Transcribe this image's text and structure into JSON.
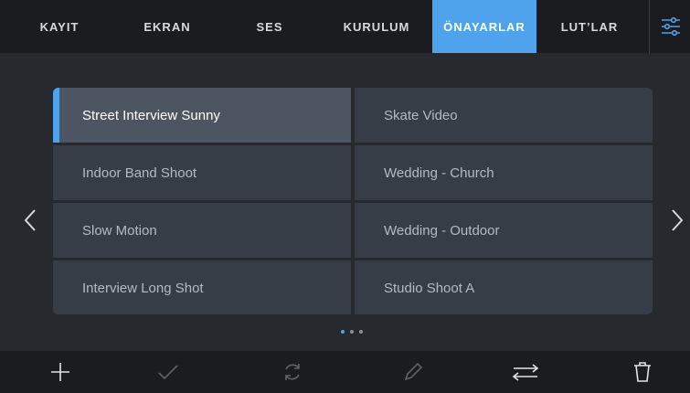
{
  "tabs": [
    {
      "label": "KAYIT"
    },
    {
      "label": "EKRAN"
    },
    {
      "label": "SES"
    },
    {
      "label": "KURULUM"
    },
    {
      "label": "ÖNAYARLAR",
      "active": true
    },
    {
      "label": "LUT’LAR"
    }
  ],
  "menu_icon": "sliders-icon",
  "presets": {
    "left": [
      {
        "label": "Street Interview Sunny",
        "selected": true
      },
      {
        "label": "Indoor Band Shoot"
      },
      {
        "label": "Slow Motion"
      },
      {
        "label": "Interview Long Shot"
      }
    ],
    "right": [
      {
        "label": "Skate Video"
      },
      {
        "label": "Wedding  - Church"
      },
      {
        "label": "Wedding - Outdoor"
      },
      {
        "label": "Studio Shoot A"
      }
    ]
  },
  "pagination": {
    "current_page": 1,
    "total_pages": 3
  },
  "toolbar": {
    "icons": [
      "plus-icon",
      "checkmark-icon",
      "refresh-icon",
      "pencil-icon",
      "swap-arrows-icon",
      "trash-icon"
    ]
  },
  "colors": {
    "accent": "#4ea3ec",
    "bar": "#1a1c20",
    "background": "#26292e",
    "tile": "#373d46",
    "tile_selected": "#4e5562"
  }
}
